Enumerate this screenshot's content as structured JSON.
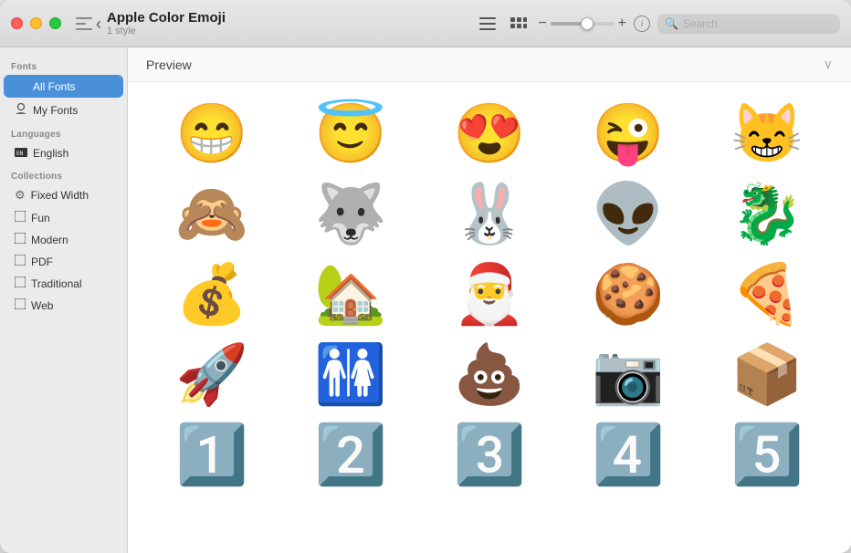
{
  "window": {
    "title": "Apple Color Emoji",
    "subtitle": "1 style"
  },
  "titlebar": {
    "back_label": "‹",
    "list_icon": "≡",
    "grid_icon": "⊞",
    "minus": "−",
    "plus": "+",
    "info": "i",
    "search_placeholder": "Search",
    "slider_value": 60
  },
  "sidebar": {
    "fonts_label": "Fonts",
    "all_fonts_label": "All Fonts",
    "my_fonts_label": "My Fonts",
    "languages_label": "Languages",
    "english_label": "English",
    "collections_label": "Collections",
    "fixed_width_label": "Fixed Width",
    "fun_label": "Fun",
    "modern_label": "Modern",
    "pdf_label": "PDF",
    "traditional_label": "Traditional",
    "web_label": "Web"
  },
  "content": {
    "preview_label": "Preview",
    "emojis": [
      "😁",
      "😇",
      "😍",
      "😜",
      "😸",
      "🙈",
      "🐺",
      "🐰",
      "👽",
      "🐉",
      "💰",
      "🏡",
      "🎅",
      "🍪",
      "🍕",
      "🚀",
      "🚻",
      "💩",
      "📷",
      "📦",
      "1️⃣",
      "2️⃣",
      "3️⃣",
      "4️⃣",
      "5️⃣"
    ]
  }
}
